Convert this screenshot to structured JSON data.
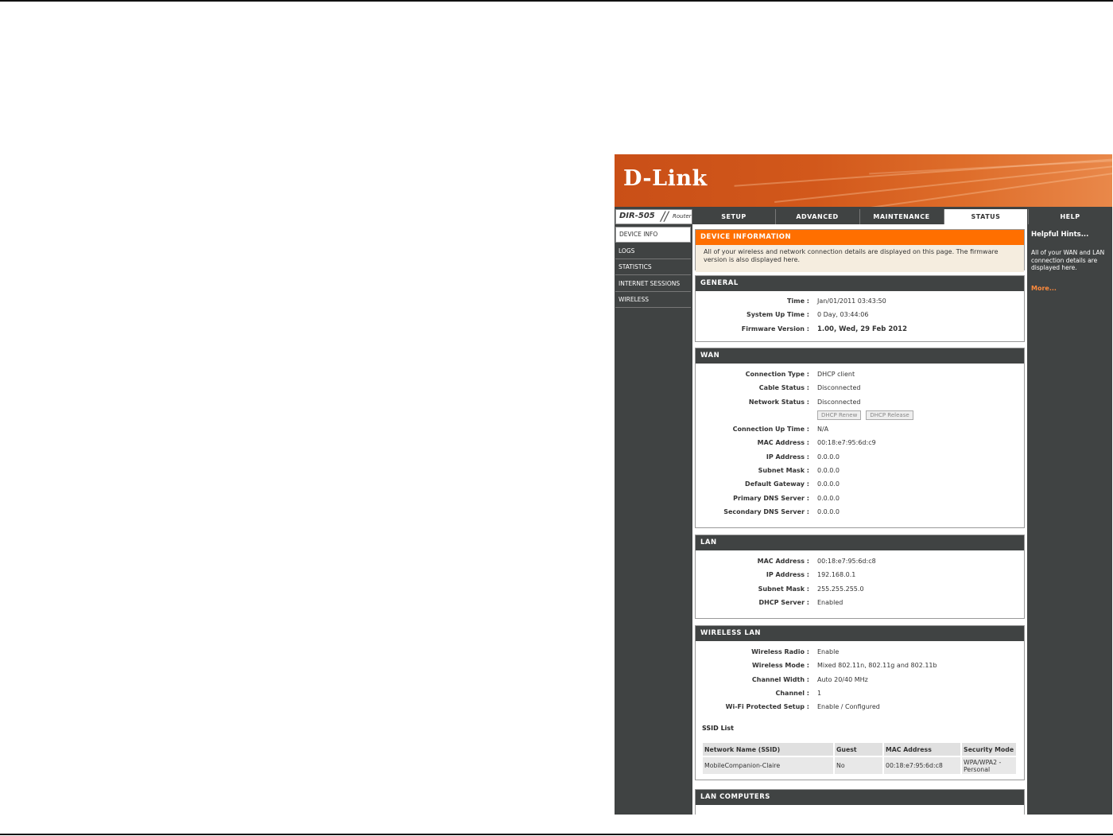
{
  "header": {
    "logo_text": "D-Link",
    "model": "DIR-505",
    "model_type": "Router"
  },
  "tabs": [
    {
      "label": "SETUP"
    },
    {
      "label": "ADVANCED"
    },
    {
      "label": "MAINTENANCE"
    },
    {
      "label": "STATUS"
    },
    {
      "label": "HELP"
    }
  ],
  "sidebar": {
    "items": [
      {
        "label": "DEVICE INFO"
      },
      {
        "label": "LOGS"
      },
      {
        "label": "STATISTICS"
      },
      {
        "label": "INTERNET SESSIONS"
      },
      {
        "label": "WIRELESS"
      }
    ]
  },
  "device_info": {
    "title": "DEVICE INFORMATION",
    "intro": "All of your wireless and network connection details are displayed on this page. The firmware version is also displayed here."
  },
  "general": {
    "title": "GENERAL",
    "rows": [
      {
        "label": "Time :",
        "value": "Jan/01/2011 03:43:50"
      },
      {
        "label": "System Up Time :",
        "value": "0 Day, 03:44:06"
      },
      {
        "label": "Firmware Version :",
        "value": "1.00,  Wed, 29 Feb 2012"
      }
    ]
  },
  "wan": {
    "title": "WAN",
    "rows_top": [
      {
        "label": "Connection Type :",
        "value": "DHCP client"
      },
      {
        "label": "Cable Status :",
        "value": "Disconnected"
      },
      {
        "label": "Network Status :",
        "value": "Disconnected"
      }
    ],
    "renew_label": "DHCP Renew",
    "release_label": "DHCP Release",
    "rows_bottom": [
      {
        "label": "Connection Up Time :",
        "value": "N/A"
      },
      {
        "label": "MAC Address :",
        "value": "00:18:e7:95:6d:c9"
      },
      {
        "label": "IP Address :",
        "value": "0.0.0.0"
      },
      {
        "label": "Subnet Mask :",
        "value": "0.0.0.0"
      },
      {
        "label": "Default Gateway :",
        "value": "0.0.0.0"
      },
      {
        "label": "Primary DNS Server :",
        "value": "0.0.0.0"
      },
      {
        "label": "Secondary DNS Server :",
        "value": "0.0.0.0"
      }
    ]
  },
  "lan": {
    "title": "LAN",
    "rows": [
      {
        "label": "MAC Address :",
        "value": "00:18:e7:95:6d:c8"
      },
      {
        "label": "IP Address :",
        "value": "192.168.0.1"
      },
      {
        "label": "Subnet Mask :",
        "value": "255.255.255.0"
      },
      {
        "label": "DHCP Server :",
        "value": "Enabled"
      }
    ]
  },
  "wireless": {
    "title": "WIRELESS LAN",
    "rows": [
      {
        "label": "Wireless Radio :",
        "value": "Enable"
      },
      {
        "label": "Wireless Mode :",
        "value": "Mixed 802.11n, 802.11g and 802.11b"
      },
      {
        "label": "Channel Width :",
        "value": "Auto 20/40 MHz"
      },
      {
        "label": "Channel :",
        "value": "1"
      },
      {
        "label": "Wi-Fi Protected Setup :",
        "value": "Enable / Configured"
      }
    ],
    "ssid_list_title": "SSID List",
    "ssid_headers": [
      "Network Name (SSID)",
      "Guest",
      "MAC Address",
      "Security Mode"
    ],
    "ssid_rows": [
      [
        "MobileCompanion-Claire",
        "No",
        "00:18:e7:95:6d:c8",
        "WPA/WPA2 - Personal"
      ]
    ]
  },
  "lan_computers": {
    "title": "LAN COMPUTERS"
  },
  "hints": {
    "title": "Helpful Hints...",
    "text": "All of your WAN and LAN connection details are displayed here.",
    "more": "More..."
  }
}
